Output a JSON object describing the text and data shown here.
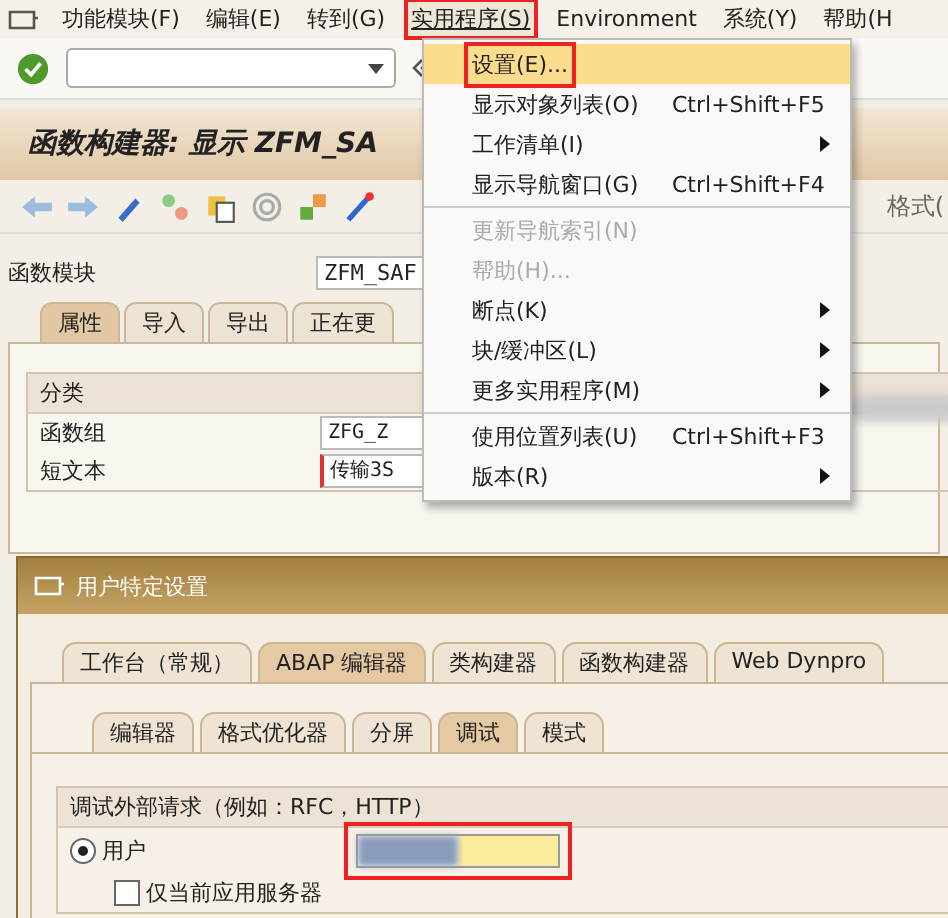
{
  "menu_bar": [
    {
      "label": "功能模块(F)",
      "selected": false
    },
    {
      "label": "编辑(E)",
      "selected": false
    },
    {
      "label": "转到(G)",
      "selected": false
    },
    {
      "label": "实用程序(S)",
      "selected": true
    },
    {
      "label": "Environment",
      "selected": false
    },
    {
      "label": "系统(Y)",
      "selected": false
    },
    {
      "label": "帮助(H",
      "selected": false
    }
  ],
  "title": "函数构建器: 显示 ZFM_SA",
  "app_toolbar_label": "格式(",
  "function_module": {
    "label": "函数模块",
    "value": "ZFM_SAF"
  },
  "tabs": [
    {
      "label": "属性",
      "selected": true
    },
    {
      "label": "导入",
      "selected": false
    },
    {
      "label": "导出",
      "selected": false
    },
    {
      "label": "正在更",
      "selected": false
    }
  ],
  "classification": {
    "title": "分类",
    "fields": [
      {
        "label": "函数组",
        "value": "ZFG_Z",
        "required": false
      },
      {
        "label": "短文本",
        "value": "传输3S",
        "required": true
      }
    ]
  },
  "dropdown_menu": [
    [
      {
        "label": "设置(E)...",
        "selected": true,
        "disabled": false,
        "submenu": false
      },
      {
        "label": "显示对象列表(O)",
        "shortcut": "Ctrl+Shift+F5",
        "selected": false,
        "disabled": false,
        "submenu": false
      },
      {
        "label": "工作清单(I)",
        "selected": false,
        "disabled": false,
        "submenu": true
      },
      {
        "label": "显示导航窗口(G)",
        "shortcut": "Ctrl+Shift+F4",
        "selected": false,
        "disabled": false,
        "submenu": false
      }
    ],
    [
      {
        "label": "更新导航索引(N)",
        "selected": false,
        "disabled": true,
        "submenu": false
      },
      {
        "label": "帮助(H)...",
        "selected": false,
        "disabled": true,
        "submenu": false
      },
      {
        "label": "断点(K)",
        "selected": false,
        "disabled": false,
        "submenu": true
      },
      {
        "label": "块/缓冲区(L)",
        "selected": false,
        "disabled": false,
        "submenu": true
      },
      {
        "label": "更多实用程序(M)",
        "selected": false,
        "disabled": false,
        "submenu": true
      }
    ],
    [
      {
        "label": "使用位置列表(U)",
        "shortcut": "Ctrl+Shift+F3",
        "selected": false,
        "disabled": false,
        "submenu": false
      },
      {
        "label": "版本(R)",
        "selected": false,
        "disabled": false,
        "submenu": true
      }
    ]
  ],
  "dialog": {
    "title": "用户特定设置",
    "tabs": [
      {
        "label": "工作台（常规）",
        "selected": false
      },
      {
        "label": "ABAP 编辑器",
        "selected": true
      },
      {
        "label": "类构建器",
        "selected": false
      },
      {
        "label": "函数构建器",
        "selected": false
      },
      {
        "label": "Web Dynpro",
        "selected": false
      }
    ],
    "subtabs": [
      {
        "label": "编辑器",
        "selected": false
      },
      {
        "label": "格式优化器",
        "selected": false
      },
      {
        "label": "分屏",
        "selected": false
      },
      {
        "label": "调试",
        "selected": true
      },
      {
        "label": "模式",
        "selected": false
      }
    ],
    "group_title": "调试外部请求（例如：RFC，HTTP）",
    "radio": {
      "label": "用户",
      "selected": true
    },
    "user_field": {
      "highlighted": true
    },
    "checkbox": {
      "label": "仅当前应用服务器",
      "checked": false
    }
  }
}
